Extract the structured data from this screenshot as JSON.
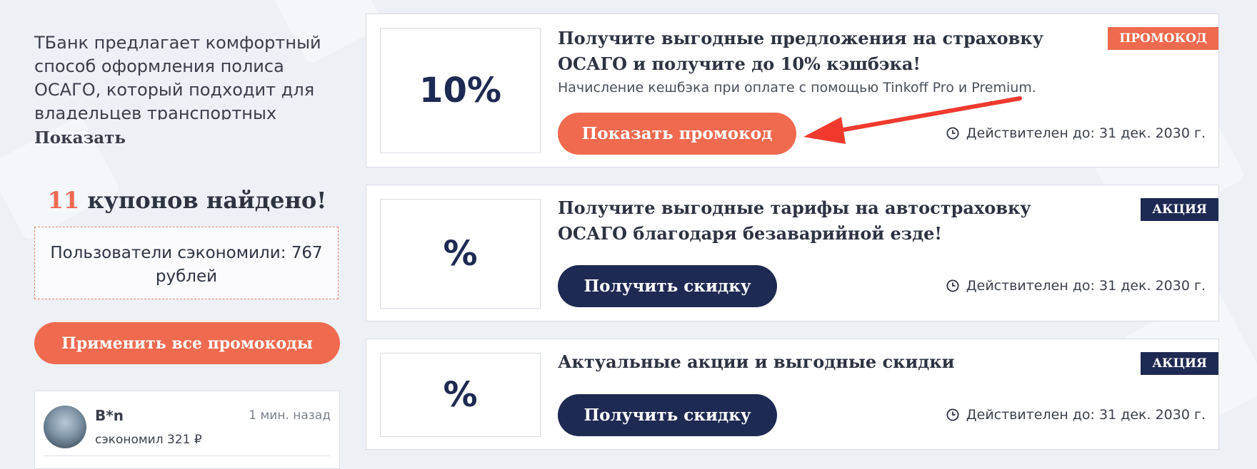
{
  "sidebar": {
    "description": "ТБанк предлагает комфортный способ оформления полиса ОСАГО, который подходит для владельцев транспортных средств, ценящих",
    "show_more": "Показать",
    "found_count": "11",
    "found_text": " купонов найдено!",
    "saved_text": "Пользователи сэкономили: 767 рублей",
    "apply_all": "Применить все промокоды",
    "activity": {
      "user": "B*n",
      "time": "1 мин. назад",
      "saved": "сэкономил 321 ₽"
    }
  },
  "coupons": [
    {
      "thumb": "10%",
      "title": "Получите выгодные предложения на страховку ОСАГО и получите до 10% кэшбэка!",
      "subtitle": "Начисление кешбэка при оплате с помощью Tinkoff Pro и Premium.",
      "badge": "ПРОМОКОД",
      "button": "Показать промокод",
      "valid": "Действителен до: 31 дек. 2030 г."
    },
    {
      "thumb": "%",
      "title": "Получите выгодные тарифы на автостраховку ОСАГО благодаря безаварийной езде!",
      "badge": "АКЦИЯ",
      "button": "Получить скидку",
      "valid": "Действителен до: 31 дек. 2030 г."
    },
    {
      "thumb": "%",
      "title": "Актуальные акции и выгодные скидки",
      "badge": "АКЦИЯ",
      "button": "Получить скидку",
      "valid": "Действителен до: 31 дек. 2030 г."
    }
  ],
  "icons": {
    "clock": "clock-icon",
    "arrow": "red-arrow-annotation"
  },
  "colors": {
    "accent": "#ef6a4f",
    "navy": "#1f2a52",
    "arrow": "#f03a2e"
  }
}
